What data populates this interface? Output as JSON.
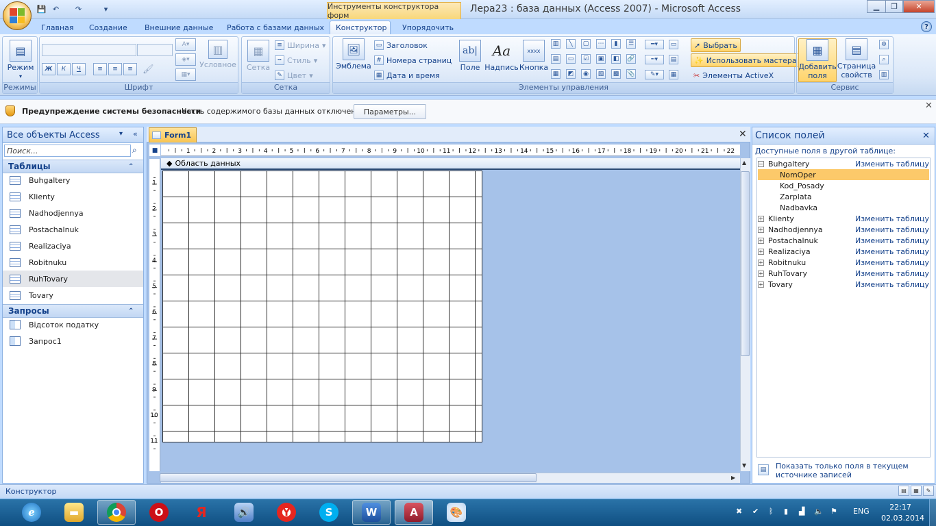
{
  "window": {
    "context_tab_header": "Инструменты конструктора форм",
    "title": "Лера23 : база данных (Access 2007) - Microsoft Access"
  },
  "tabs": [
    {
      "label": "Главная"
    },
    {
      "label": "Создание"
    },
    {
      "label": "Внешние данные"
    },
    {
      "label": "Работа с базами данных"
    },
    {
      "label": "Конструктор",
      "active": true
    },
    {
      "label": "Упорядочить"
    }
  ],
  "ribbon": {
    "modes": {
      "view_label": "Режим",
      "group_label": "Режимы"
    },
    "font": {
      "bold": "Ж",
      "italic": "К",
      "underline": "Ч",
      "conditional": "Условное",
      "group_label": "Шрифт"
    },
    "grid": {
      "grid_label": "Сетка",
      "width": "Ширина",
      "style": "Стиль",
      "color": "Цвет",
      "group_label": "Сетка"
    },
    "controls": {
      "logo": "Эмблема",
      "title": "Заголовок",
      "page_numbers": "Номера страниц",
      "date_time": "Дата и время",
      "field": "Поле",
      "label": "Надпись",
      "button": "Кнопка",
      "field_icon_text": "ab|",
      "label_icon_text": "Aa",
      "button_icon_text": "xxxx",
      "select": "Выбрать",
      "use_wizards": "Использовать мастера",
      "activex": "Элементы ActiveX",
      "group_label": "Элементы управления"
    },
    "tools": {
      "add_fields": "Добавить поля",
      "property_sheet": "Страница свойств",
      "group_label": "Сервис"
    }
  },
  "security": {
    "title": "Предупреждение системы безопасности",
    "message": "Часть содержимого базы данных отключено",
    "button": "Параметры..."
  },
  "nav": {
    "header": "Все объекты Access",
    "search_placeholder": "Поиск...",
    "tables_header": "Таблицы",
    "tables": [
      "Buhgaltery",
      "Klienty",
      "Nadhodjennya",
      "Postachalnuk",
      "Realizaciya",
      "Robitnuku",
      "RuhTovary",
      "Tovary"
    ],
    "selected_table": "RuhTovary",
    "queries_header": "Запросы",
    "queries": [
      "Відсоток податку",
      "Запрос1"
    ]
  },
  "document": {
    "tab_label": "Form1",
    "section_label": "Область данных",
    "hruler_ticks": [
      "1",
      "2",
      "3",
      "4",
      "5",
      "6",
      "7",
      "8",
      "9",
      "10",
      "11",
      "12",
      "13",
      "14",
      "15",
      "16",
      "17",
      "18",
      "19",
      "20",
      "21",
      "22"
    ],
    "vruler_ticks": [
      "1",
      "2",
      "3",
      "4",
      "5",
      "6",
      "7",
      "8",
      "9",
      "10",
      "11"
    ]
  },
  "fieldlist": {
    "title": "Список полей",
    "subtitle": "Доступные поля в другой таблице:",
    "edit_link": "Изменить таблицу",
    "expanded_table": "Buhgaltery",
    "fields": [
      "NomOper",
      "Kod_Posady",
      "Zarplata",
      "Nadbavka"
    ],
    "highlighted_field": "NomOper",
    "tables": [
      "Klienty",
      "Nadhodjennya",
      "Postachalnuk",
      "Realizaciya",
      "Robitnuku",
      "RuhTovary",
      "Tovary"
    ],
    "footer": "Показать только поля в текущем источнике записей"
  },
  "status": {
    "text": "Конструктор"
  },
  "taskbar": {
    "lang": "ENG",
    "time": "22:17",
    "date": "02.03.2014"
  },
  "colors": {
    "accent": "#15428b",
    "ribbon_highlight": "#ffd46b",
    "field_highlight": "#fcc96a",
    "taskbar": "#0f4f82"
  }
}
